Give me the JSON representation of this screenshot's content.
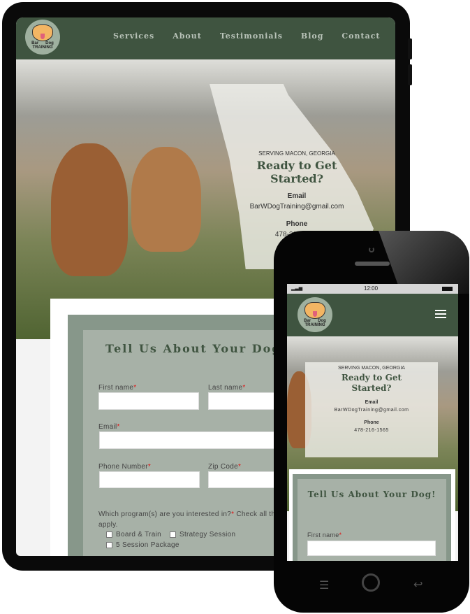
{
  "site": {
    "logo": {
      "top": "Bar",
      "right": "Dog",
      "bottom": "TRAINING"
    },
    "nav": [
      "Services",
      "About",
      "Testimonials",
      "Blog",
      "Contact"
    ],
    "hero": {
      "eyebrow": "SERVING MACON, GEORGIA",
      "title": "Ready to Get Started?",
      "email_label": "Email",
      "email": "BarWDogTraining@gmail.com",
      "phone_label": "Phone",
      "phone": "478-216-1565"
    },
    "form": {
      "title": "Tell Us About Your Dog!",
      "first_name": "First name",
      "last_name": "Last name",
      "email": "Email",
      "phone": "Phone Number",
      "zip": "Zip Code",
      "required": "*",
      "program_q": "Which program(s) are you interested in?",
      "program_hint": "Check all that apply.",
      "options": [
        "Board & Train",
        "Strategy Session",
        "5 Session Package"
      ]
    }
  },
  "phone_status": {
    "time": "12:00"
  },
  "colors": {
    "nav": "#3f5440",
    "frame": "#87978a",
    "inner": "#a7b1a7",
    "title": "#3f5440",
    "required": "#e01010"
  },
  "icons": {
    "menu": "hamburger-icon",
    "signal": "signal-icon",
    "battery": "battery-icon",
    "home": "power-icon",
    "back": "back-icon",
    "list": "menu-lines-icon"
  }
}
